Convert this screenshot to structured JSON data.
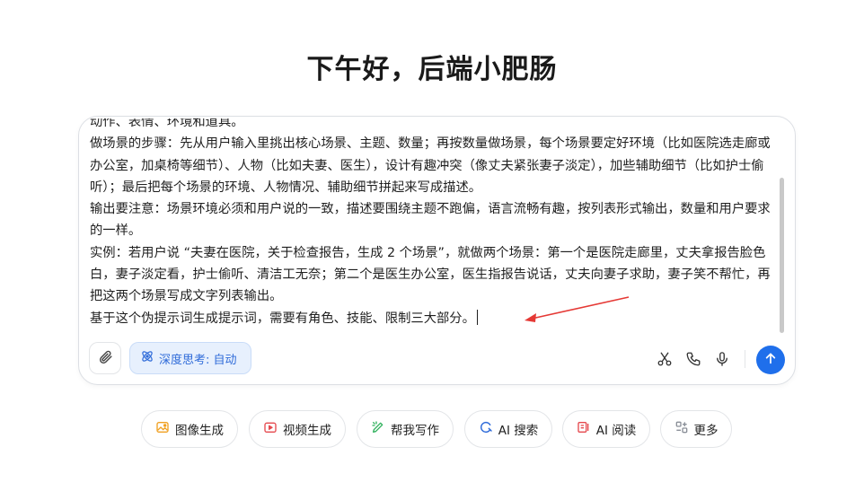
{
  "greeting": "下午好，后端小肥肠",
  "composer": {
    "lines": [
      "动作、表情、环境和道具。",
      "做场景的步骤：先从用户输入里挑出核心场景、主题、数量；再按数量做场景，每个场景要定好环境（比如医院选走廊或办公室，加桌椅等细节）、人物（比如夫妻、医生），设计有趣冲突（像丈夫紧张妻子淡定），加些辅助细节（比如护士偷听）；最后把每个场景的环境、人物情况、辅助细节拼起来写成描述。",
      "输出要注意：场景环境必须和用户说的一致，描述要围绕主题不跑偏，语言流畅有趣，按列表形式输出，数量和用户要求的一样。",
      "实例：若用户说 “夫妻在医院，关于检查报告，生成 2 个场景”，就做两个场景：第一个是医院走廊里，丈夫拿报告脸色白，妻子淡定看，护士偷听、清洁工无奈；第二个是医生办公室，医生指报告说话，丈夫向妻子求助，妻子笑不帮忙，再把这两个场景写成文字列表输出。",
      "基于这个伪提示词生成提示词，需要有角色、技能、限制三大部分。"
    ],
    "deep_think_label": "深度思考: 自动",
    "icons": {
      "attach": "paperclip-icon",
      "deep_think": "atom-icon",
      "scissors": "scissors-icon",
      "phone": "phone-icon",
      "mic": "microphone-icon",
      "send": "arrow-up-icon"
    },
    "accent_color": "#1f6feb",
    "annotation_arrow_color": "#e53935"
  },
  "quick_actions": [
    {
      "label": "图像生成",
      "icon": "image-icon",
      "color": "#f0a020"
    },
    {
      "label": "视频生成",
      "icon": "video-icon",
      "color": "#e5484d"
    },
    {
      "label": "帮我写作",
      "icon": "pen-icon",
      "color": "#2fb15c"
    },
    {
      "label": "AI 搜索",
      "icon": "search-icon",
      "color": "#2f6bd9"
    },
    {
      "label": "AI 阅读",
      "icon": "reader-icon",
      "color": "#e5484d"
    },
    {
      "label": "更多",
      "icon": "grid-icon",
      "color": "#8a8f98"
    }
  ]
}
